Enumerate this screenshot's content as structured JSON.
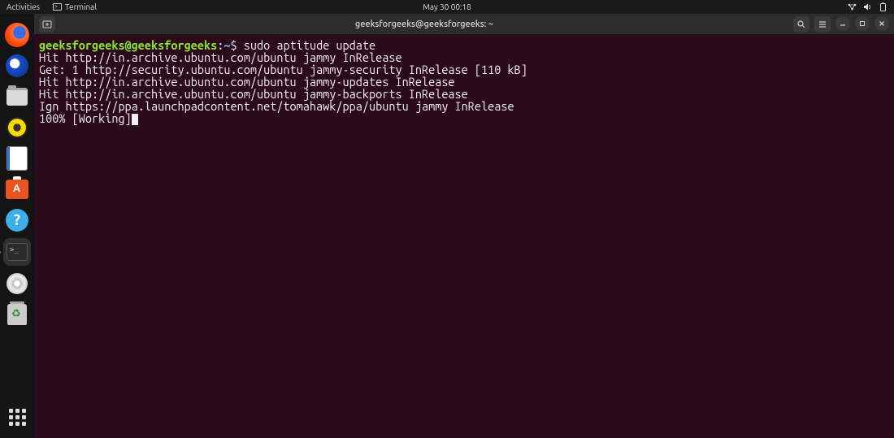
{
  "topbar": {
    "activities": "Activities",
    "terminal_label": "Terminal",
    "datetime": "May 30  00:18"
  },
  "dock": {
    "items": [
      {
        "name": "firefox"
      },
      {
        "name": "thunderbird"
      },
      {
        "name": "files"
      },
      {
        "name": "rhythmbox"
      },
      {
        "name": "writer"
      },
      {
        "name": "software"
      },
      {
        "name": "help"
      },
      {
        "name": "terminal"
      },
      {
        "name": "disc"
      },
      {
        "name": "trash"
      }
    ]
  },
  "window": {
    "title": "geeksforgeeks@geeksforgeeks: ~"
  },
  "terminal": {
    "prompt": {
      "user_host": "geeksforgeeks@geeksforgeeks",
      "colon": ":",
      "path": "~",
      "dollar": "$"
    },
    "command": "sudo aptitude update",
    "output": [
      "Hit http://in.archive.ubuntu.com/ubuntu jammy InRelease",
      "Get: 1 http://security.ubuntu.com/ubuntu jammy-security InRelease [110 kB]",
      "Hit http://in.archive.ubuntu.com/ubuntu jammy-updates InRelease",
      "Hit http://in.archive.ubuntu.com/ubuntu jammy-backports InRelease",
      "Ign https://ppa.launchpadcontent.net/tomahawk/ppa/ubuntu jammy InRelease"
    ],
    "progress": "100% [Working]"
  }
}
